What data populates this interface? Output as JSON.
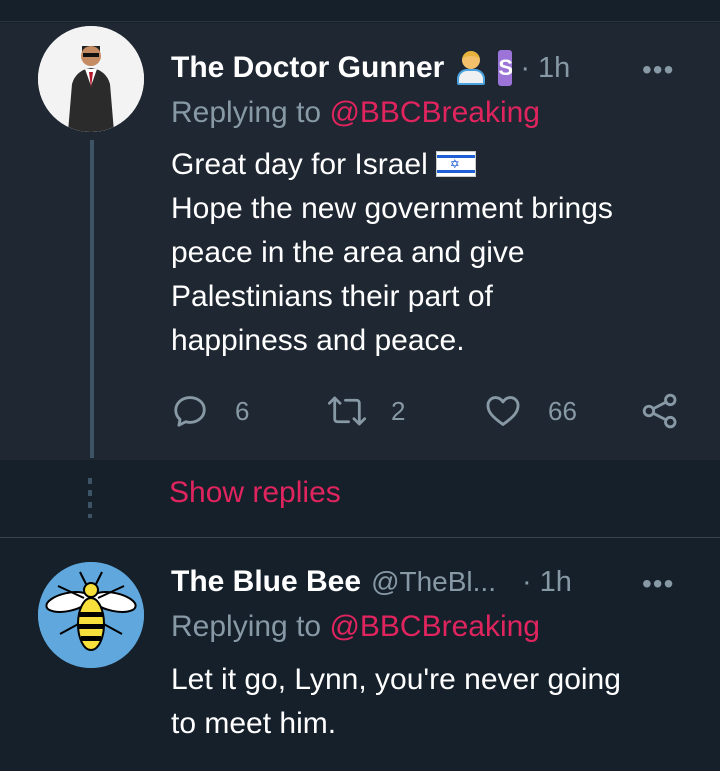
{
  "tweets": [
    {
      "name": "The Doctor Gunner",
      "handle": "",
      "time": "· 1h",
      "replying_prefix": "Replying to ",
      "replying_to": "@BBCBreaking",
      "text_line1": "Great day for Israel",
      "text_rest": [
        "Hope the new government brings",
        "peace in the area and give",
        "Palestinians their part of",
        "happiness and peace."
      ],
      "reply_count": "6",
      "retweet_count": "2",
      "like_count": "66",
      "badge_letter": "S"
    },
    {
      "name": "The Blue Bee",
      "handle": "@TheBl...",
      "time": "· 1h",
      "replying_prefix": "Replying to ",
      "replying_to": "@BBCBreaking",
      "text_lines": [
        "Let it go, Lynn, you're never going",
        "to meet him."
      ]
    }
  ],
  "show_replies": "Show replies",
  "more_label": "•••",
  "icons": {
    "reply": "reply-icon",
    "retweet": "retweet-icon",
    "like": "heart-icon",
    "share": "share-icon"
  },
  "colors": {
    "background": "#15202b",
    "highlight_background": "#1e2732",
    "accent": "#e0245e",
    "muted": "#8899a6"
  }
}
